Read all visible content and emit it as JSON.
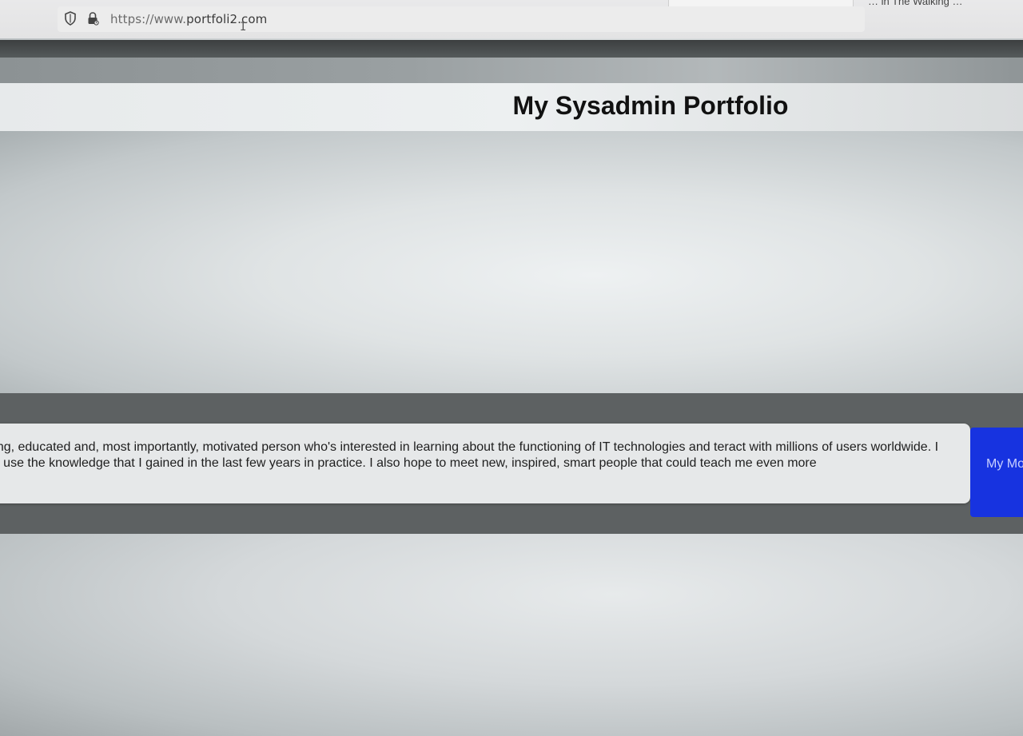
{
  "browser": {
    "url_scheme": "https://www.",
    "url_host": "portfoli2.com",
    "bookmark_partial": "… in The Walking …",
    "icons": [
      "shield-icon",
      "lock-icon"
    ]
  },
  "page": {
    "title": "My Sysadmin Portfolio",
    "about_text": "my portfolio! I see myself as a young, educated and, most importantly, motivated person who's interested in learning about the functioning of IT technologies and teract with millions of users worldwide. I would love to use the knowledge that I gained in the last few years in practice. I also hope to meet new, inspired, smart people that could teach me even more",
    "motivation_button_label": "My Motiva",
    "colors": {
      "button_blue": "#1733e0",
      "band_dark": "#5d6162",
      "card_light": "#e6e8e9"
    }
  }
}
